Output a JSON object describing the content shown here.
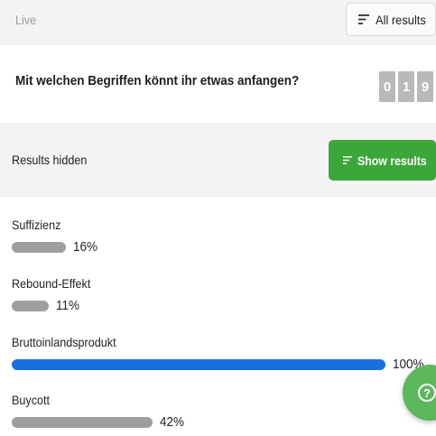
{
  "header": {
    "status": "Live",
    "all_results_label": "All results",
    "all_results_icon": "filter-lines-icon"
  },
  "question": {
    "text": "Mit welchen Begriffen könnt ihr etwas anfangen?",
    "counter_digits": [
      "0",
      "1",
      "9"
    ]
  },
  "results_panel": {
    "status_text": "Results hidden",
    "show_button_label": "Show results",
    "show_button_icon": "filter-lines-icon",
    "show_button_color": "#3ca63a"
  },
  "options": [
    {
      "label": "Suffizienz",
      "percent_text": "16%",
      "percent": 16,
      "highlighted": false
    },
    {
      "label": "Rebound-Effekt",
      "percent_text": "11%",
      "percent": 11,
      "highlighted": false
    },
    {
      "label": "Bruttoinlandsprodukt",
      "percent_text": "100%",
      "percent": 100,
      "highlighted": true
    },
    {
      "label": "Buycott",
      "percent_text": "42%",
      "percent": 42,
      "highlighted": false
    }
  ],
  "colors": {
    "bar_default": "#9e9e9e",
    "bar_highlight": "#1a6fe0",
    "fab": "#5cb85c"
  },
  "help_fab": {
    "icon": "question-mark-icon",
    "glyph": "?"
  }
}
